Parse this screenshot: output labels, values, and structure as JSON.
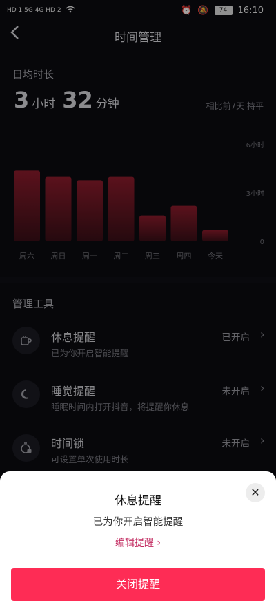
{
  "status": {
    "left": "HD 1 5G 4G HD 2",
    "alarm_icon": "alarm-icon",
    "mute_icon": "bell-off-icon",
    "battery": "74",
    "time": "16:10"
  },
  "header": {
    "title": "时间管理",
    "back_icon": "chevron-left-icon"
  },
  "daily": {
    "label": "日均时长",
    "hours": "3",
    "hours_unit": "小时",
    "minutes": "32",
    "minutes_unit": "分钟",
    "compare": "相比前7天 持平"
  },
  "chart_data": {
    "type": "bar",
    "categories": [
      "周六",
      "周日",
      "周一",
      "周二",
      "周三",
      "周四",
      "今天"
    ],
    "values": [
      4.4,
      4.0,
      3.8,
      4.0,
      1.6,
      2.2,
      0.7
    ],
    "ylim": [
      0,
      6
    ],
    "yticks": [
      {
        "value": 6,
        "label": "6小时"
      },
      {
        "value": 3,
        "label": "3小时"
      },
      {
        "value": 0,
        "label": "0"
      }
    ],
    "bar_color": "#6e1521",
    "bar_color_light": "#8c1c2c"
  },
  "tools": {
    "label": "管理工具",
    "items": [
      {
        "title": "休息提醒",
        "subtitle": "已为你开启智能提醒",
        "status": "已开启",
        "icon": "coffee-cup-icon"
      },
      {
        "title": "睡觉提醒",
        "subtitle": "睡眠时间内打开抖音，将提醒你休息",
        "status": "未开启",
        "icon": "moon-icon"
      },
      {
        "title": "时间锁",
        "subtitle": "可设置单次使用时长",
        "status": "未开启",
        "icon": "timer-lock-icon"
      }
    ]
  },
  "sheet": {
    "title": "休息提醒",
    "subtitle": "已为你开启智能提醒",
    "link": "编辑提醒",
    "button": "关闭提醒",
    "accent": "#fe2c55"
  }
}
